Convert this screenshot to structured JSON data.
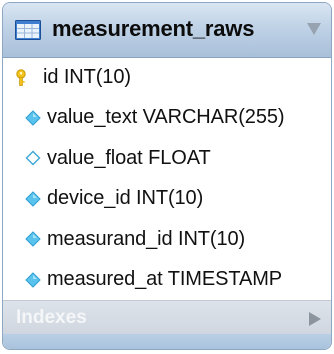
{
  "table": {
    "name": "measurement_raws",
    "columns": [
      {
        "label": "id INT(10)",
        "icon": "primary-key-icon"
      },
      {
        "label": "value_text VARCHAR(255)",
        "icon": "filled-diamond-icon"
      },
      {
        "label": "value_float FLOAT",
        "icon": "outlined-diamond-icon"
      },
      {
        "label": "device_id INT(10)",
        "icon": "filled-diamond-icon"
      },
      {
        "label": "measurand_id INT(10)",
        "icon": "filled-diamond-icon"
      },
      {
        "label": "measured_at TIMESTAMP",
        "icon": "filled-diamond-icon"
      }
    ],
    "indexes_label": "Indexes"
  },
  "colors": {
    "header_gradient_top": "#d9e5f2",
    "header_gradient_bottom": "#a9c0da",
    "key_icon": "#f2c21a",
    "diamond_fill": "#59c3ee",
    "diamond_outline": "#3aa7d8"
  }
}
